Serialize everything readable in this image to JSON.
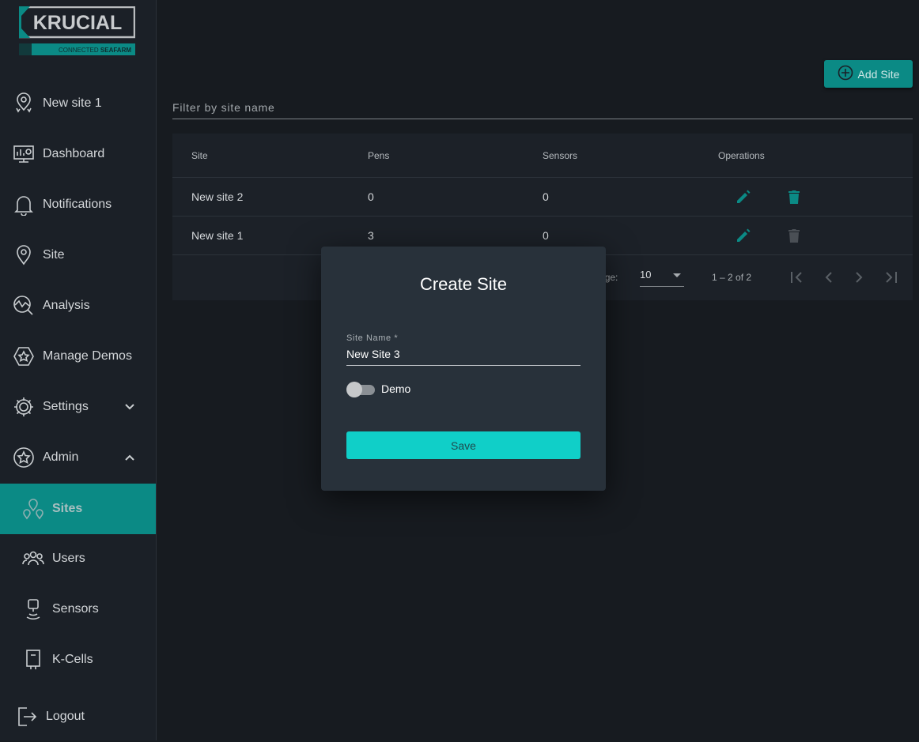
{
  "logo": {
    "name": "KRUCIAL",
    "tagline_a": "CONNECTED",
    "tagline_b": "SEAFARM"
  },
  "sidebar": {
    "items": [
      {
        "label": "New site 1",
        "icon": "location-pin-icon"
      },
      {
        "label": "Dashboard",
        "icon": "dashboard-icon"
      },
      {
        "label": "Notifications",
        "icon": "bell-icon"
      },
      {
        "label": "Site",
        "icon": "location-pin-icon"
      },
      {
        "label": "Analysis",
        "icon": "analysis-icon"
      },
      {
        "label": "Manage Demos",
        "icon": "star-hexagon-icon"
      },
      {
        "label": "Settings",
        "icon": "gear-icon"
      },
      {
        "label": "Admin",
        "icon": "star-circle-icon"
      },
      {
        "label": "Sites",
        "icon": "multi-pin-icon"
      },
      {
        "label": "Users",
        "icon": "users-icon"
      },
      {
        "label": "Sensors",
        "icon": "sensor-icon"
      },
      {
        "label": "K-Cells",
        "icon": "kcell-icon"
      },
      {
        "label": "Logout",
        "icon": "logout-icon"
      }
    ]
  },
  "toolbar": {
    "add_label": "Add Site"
  },
  "filter": {
    "placeholder": "Filter by site name"
  },
  "table": {
    "headers": [
      "Site",
      "Pens",
      "Sensors",
      "Operations"
    ],
    "rows": [
      {
        "site": "New site 2",
        "pens": "0",
        "sensors": "0",
        "delete_enabled": true
      },
      {
        "site": "New site 1",
        "pens": "3",
        "sensors": "0",
        "delete_enabled": false
      }
    ],
    "paginator": {
      "label": "Items per page:",
      "page_size": "10",
      "range": "1 – 2 of 2"
    }
  },
  "dialog": {
    "title": "Create Site",
    "field_label": "Site Name *",
    "field_value": "New Site 3",
    "toggle_label": "Demo",
    "toggle_on": false,
    "save_label": "Save"
  },
  "colors": {
    "accent": "#0b8a85",
    "save": "#10cfc8",
    "delete_active": "#0b8a85",
    "delete_disabled": "#4a4f55"
  }
}
